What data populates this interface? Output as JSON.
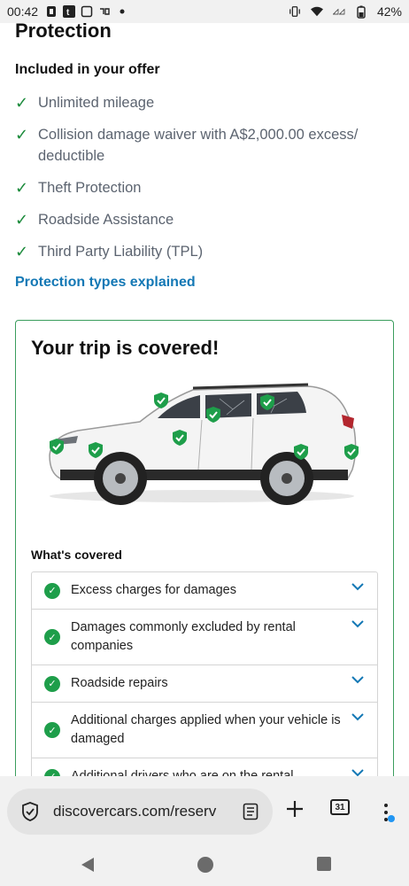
{
  "status_bar": {
    "time": "00:42",
    "battery": "42%",
    "icons": [
      "notification-icon",
      "tumblr-icon",
      "screen-icon",
      "app-icon",
      "dot-icon",
      "vibrate-icon",
      "wifi-icon",
      "signal-icon",
      "battery-icon"
    ]
  },
  "page": {
    "title": "Protection",
    "offer_heading": "Included in your offer",
    "offer_items": [
      "Unlimited mileage",
      "Collision damage waiver with A$2,000.00 excess/ deductible",
      "Theft Protection",
      "Roadside Assistance",
      "Third Party Liability (TPL)"
    ],
    "protection_link": "Protection types explained",
    "card": {
      "title": "Your trip is covered!",
      "covered_heading": "What's covered",
      "covered_items": [
        "Excess charges for damages",
        "Damages commonly excluded by rental companies",
        "Roadside repairs",
        "Additional charges applied when your vehicle is damaged",
        "Additional drivers who are on the rental"
      ]
    }
  },
  "browser": {
    "url": "discovercars.com/reserv",
    "tab_count": "31"
  },
  "colors": {
    "accent_green": "#1e9e4a",
    "link_blue": "#1478b5",
    "card_border": "#3a9d5d"
  }
}
